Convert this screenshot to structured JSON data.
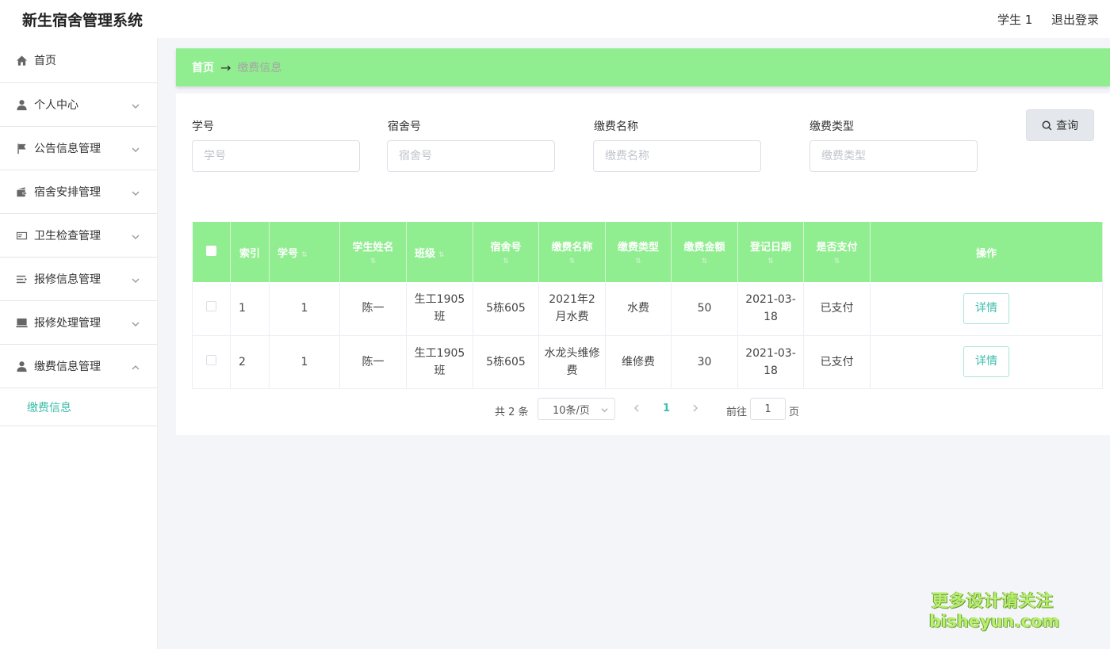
{
  "header": {
    "title": "新生宿舍管理系统",
    "user": "学生 1",
    "logout": "退出登录"
  },
  "sidebar": {
    "items": [
      {
        "label": "首页",
        "icon": "home-icon"
      },
      {
        "label": "个人中心",
        "icon": "user-icon"
      },
      {
        "label": "公告信息管理",
        "icon": "flag-icon"
      },
      {
        "label": "宿舍安排管理",
        "icon": "wallet-icon"
      },
      {
        "label": "卫生检查管理",
        "icon": "card-icon"
      },
      {
        "label": "报修信息管理",
        "icon": "list-icon"
      },
      {
        "label": "报修处理管理",
        "icon": "monitor-icon"
      },
      {
        "label": "缴费信息管理",
        "icon": "user-icon"
      }
    ],
    "active_sub": "缴费信息"
  },
  "breadcrumb": {
    "home": "首页",
    "separator": "→",
    "current": "缴费信息"
  },
  "search": {
    "fields": [
      {
        "label": "学号",
        "placeholder": "学号"
      },
      {
        "label": "宿舍号",
        "placeholder": "宿舍号"
      },
      {
        "label": "缴费名称",
        "placeholder": "缴费名称"
      },
      {
        "label": "缴费类型",
        "placeholder": "缴费类型"
      }
    ],
    "button": "查询"
  },
  "table": {
    "headers": [
      "索引",
      "学号",
      "学生姓名",
      "班级",
      "宿舍号",
      "缴费名称",
      "缴费类型",
      "缴费金额",
      "登记日期",
      "是否支付",
      "操作"
    ],
    "rows": [
      {
        "index": "1",
        "student_id": "1",
        "name": "陈一",
        "class": "生工1905班",
        "room": "5栋605",
        "fee_name": "2021年2月水费",
        "fee_type": "水费",
        "amount": "50",
        "date": "2021-03-18",
        "paid": "已支付",
        "action": "详情"
      },
      {
        "index": "2",
        "student_id": "1",
        "name": "陈一",
        "class": "生工1905班",
        "room": "5栋605",
        "fee_name": "水龙头维修费",
        "fee_type": "维修费",
        "amount": "30",
        "date": "2021-03-18",
        "paid": "已支付",
        "action": "详情"
      }
    ]
  },
  "pagination": {
    "total": "共 2 条",
    "page_size": "10条/页",
    "current": "1",
    "goto": "前往",
    "goto_value": "1",
    "unit": "页"
  },
  "watermark": {
    "line1": "更多设计请关注",
    "line2": "bisheyun.com"
  },
  "colors": {
    "accent": "#90ee90",
    "link": "#3dbdab"
  }
}
